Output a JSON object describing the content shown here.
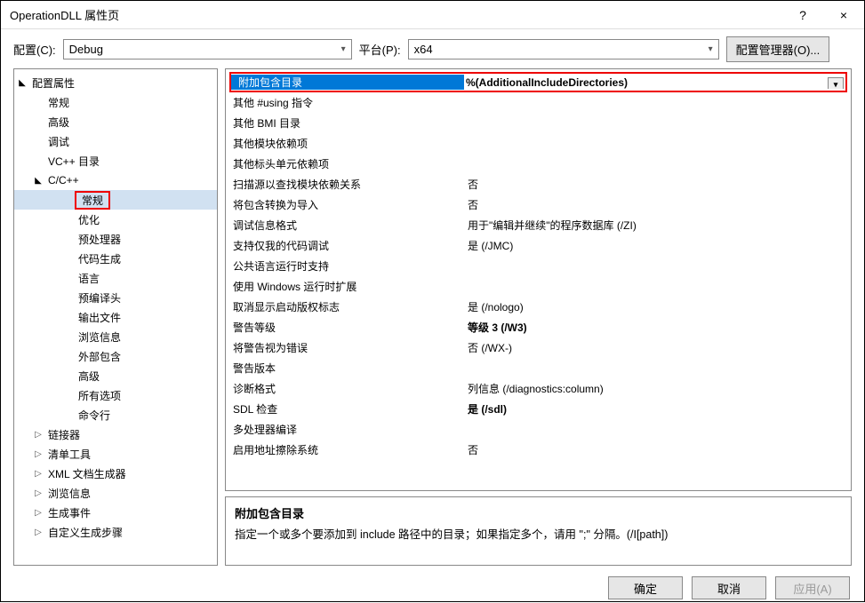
{
  "window": {
    "title": "OperationDLL 属性页",
    "help": "?",
    "close": "×"
  },
  "toolbar": {
    "config_label": "配置(C):",
    "config_value": "Debug",
    "platform_label": "平台(P):",
    "platform_value": "x64",
    "manager_button": "配置管理器(O)..."
  },
  "tree": [
    {
      "label": "配置属性",
      "depth": 0,
      "arrow": "▲",
      "interact": true,
      "boxed": false,
      "sel": false
    },
    {
      "label": "常规",
      "depth": 1,
      "arrow": "",
      "interact": true,
      "boxed": false,
      "sel": false
    },
    {
      "label": "高级",
      "depth": 1,
      "arrow": "",
      "interact": true,
      "boxed": false,
      "sel": false
    },
    {
      "label": "调试",
      "depth": 1,
      "arrow": "",
      "interact": true,
      "boxed": false,
      "sel": false
    },
    {
      "label": "VC++ 目录",
      "depth": 1,
      "arrow": "",
      "interact": true,
      "boxed": false,
      "sel": false
    },
    {
      "label": "C/C++",
      "depth": 1,
      "arrow": "▲",
      "interact": true,
      "boxed": false,
      "sel": false
    },
    {
      "label": "常规",
      "depth": 2,
      "arrow": "",
      "interact": true,
      "boxed": true,
      "sel": true
    },
    {
      "label": "优化",
      "depth": 2,
      "arrow": "",
      "interact": true,
      "boxed": false,
      "sel": false
    },
    {
      "label": "预处理器",
      "depth": 2,
      "arrow": "",
      "interact": true,
      "boxed": false,
      "sel": false
    },
    {
      "label": "代码生成",
      "depth": 2,
      "arrow": "",
      "interact": true,
      "boxed": false,
      "sel": false
    },
    {
      "label": "语言",
      "depth": 2,
      "arrow": "",
      "interact": true,
      "boxed": false,
      "sel": false
    },
    {
      "label": "预编译头",
      "depth": 2,
      "arrow": "",
      "interact": true,
      "boxed": false,
      "sel": false
    },
    {
      "label": "输出文件",
      "depth": 2,
      "arrow": "",
      "interact": true,
      "boxed": false,
      "sel": false
    },
    {
      "label": "浏览信息",
      "depth": 2,
      "arrow": "",
      "interact": true,
      "boxed": false,
      "sel": false
    },
    {
      "label": "外部包含",
      "depth": 2,
      "arrow": "",
      "interact": true,
      "boxed": false,
      "sel": false
    },
    {
      "label": "高级",
      "depth": 2,
      "arrow": "",
      "interact": true,
      "boxed": false,
      "sel": false
    },
    {
      "label": "所有选项",
      "depth": 2,
      "arrow": "",
      "interact": true,
      "boxed": false,
      "sel": false
    },
    {
      "label": "命令行",
      "depth": 2,
      "arrow": "",
      "interact": true,
      "boxed": false,
      "sel": false
    },
    {
      "label": "链接器",
      "depth": 1,
      "arrow": "▷",
      "interact": true,
      "boxed": false,
      "sel": false
    },
    {
      "label": "清单工具",
      "depth": 1,
      "arrow": "▷",
      "interact": true,
      "boxed": false,
      "sel": false
    },
    {
      "label": "XML 文档生成器",
      "depth": 1,
      "arrow": "▷",
      "interact": true,
      "boxed": false,
      "sel": false
    },
    {
      "label": "浏览信息",
      "depth": 1,
      "arrow": "▷",
      "interact": true,
      "boxed": false,
      "sel": false
    },
    {
      "label": "生成事件",
      "depth": 1,
      "arrow": "▷",
      "interact": true,
      "boxed": false,
      "sel": false
    },
    {
      "label": "自定义生成步骤",
      "depth": 1,
      "arrow": "▷",
      "interact": true,
      "boxed": false,
      "sel": false
    }
  ],
  "grid": [
    {
      "name": "附加包含目录",
      "value": "%(AdditionalIncludeDirectories)",
      "header": true,
      "bold": true
    },
    {
      "name": "其他 #using 指令",
      "value": "",
      "header": false,
      "bold": false
    },
    {
      "name": "其他 BMI 目录",
      "value": "",
      "header": false,
      "bold": false
    },
    {
      "name": "其他模块依赖项",
      "value": "",
      "header": false,
      "bold": false
    },
    {
      "name": "其他标头单元依赖项",
      "value": "",
      "header": false,
      "bold": false
    },
    {
      "name": "扫描源以查找模块依赖关系",
      "value": "否",
      "header": false,
      "bold": false
    },
    {
      "name": "将包含转换为导入",
      "value": "否",
      "header": false,
      "bold": false
    },
    {
      "name": "调试信息格式",
      "value": "用于\"编辑并继续\"的程序数据库 (/ZI)",
      "header": false,
      "bold": false
    },
    {
      "name": "支持仅我的代码调试",
      "value": "是 (/JMC)",
      "header": false,
      "bold": false
    },
    {
      "name": "公共语言运行时支持",
      "value": "",
      "header": false,
      "bold": false
    },
    {
      "name": "使用 Windows 运行时扩展",
      "value": "",
      "header": false,
      "bold": false
    },
    {
      "name": "取消显示启动版权标志",
      "value": "是 (/nologo)",
      "header": false,
      "bold": false
    },
    {
      "name": "警告等级",
      "value": "等级 3 (/W3)",
      "header": false,
      "bold": true
    },
    {
      "name": "将警告视为错误",
      "value": "否 (/WX-)",
      "header": false,
      "bold": false
    },
    {
      "name": "警告版本",
      "value": "",
      "header": false,
      "bold": false
    },
    {
      "name": "诊断格式",
      "value": "列信息 (/diagnostics:column)",
      "header": false,
      "bold": false
    },
    {
      "name": "SDL 检查",
      "value": "是 (/sdl)",
      "header": false,
      "bold": true
    },
    {
      "name": "多处理器编译",
      "value": "",
      "header": false,
      "bold": false
    },
    {
      "name": "启用地址擦除系统",
      "value": "否",
      "header": false,
      "bold": false
    }
  ],
  "description": {
    "title": "附加包含目录",
    "text": "指定一个或多个要添加到 include 路径中的目录；如果指定多个，请用 \";\" 分隔。(/I[path])"
  },
  "footer": {
    "ok": "确定",
    "cancel": "取消",
    "apply": "应用(A)"
  }
}
